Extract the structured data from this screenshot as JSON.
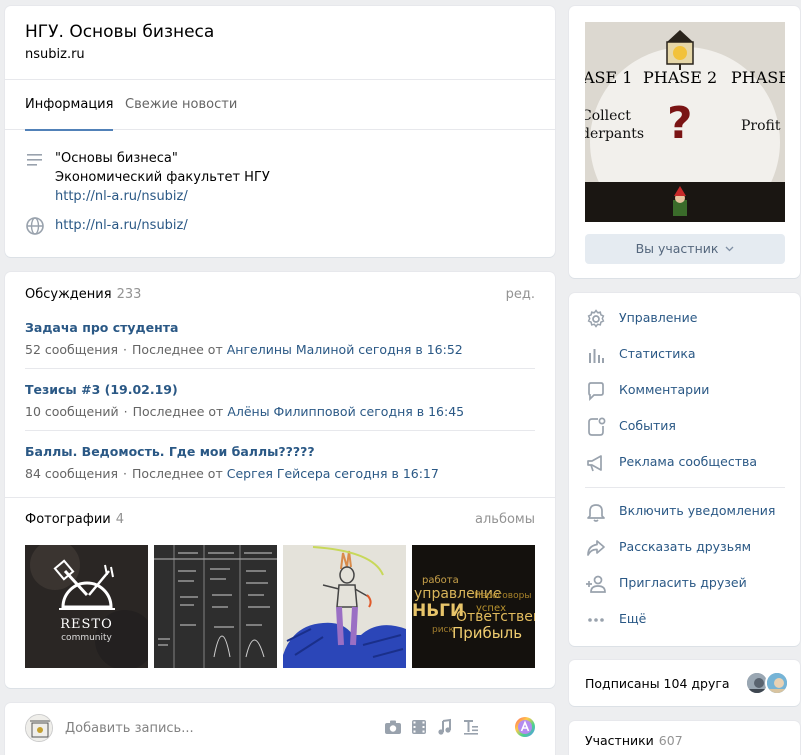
{
  "group": {
    "title": "НГУ. Основы бизнеса",
    "subtitle": "nsubiz.ru"
  },
  "tabs": [
    {
      "label": "Информация",
      "active": true
    },
    {
      "label": "Свежие новости",
      "active": false
    }
  ],
  "info": {
    "description_lines": [
      "\"Основы бизнеса\"",
      "Экономический факультет НГУ"
    ],
    "description_link": "http://nl-a.ru/nsubiz/",
    "website_link": "http://nl-a.ru/nsubiz/"
  },
  "discussions": {
    "title": "Обсуждения",
    "count": "233",
    "action": "ред.",
    "topics": [
      {
        "title": "Задача про студента",
        "count": "52 сообщения",
        "last_prefix": "Последнее от",
        "last_link": "Ангелины Малиной сегодня в 16:52"
      },
      {
        "title": "Тезисы #3 (19.02.19)",
        "count": "10 сообщений",
        "last_prefix": "Последнее от",
        "last_link": "Алёны Филипповой сегодня в 16:45"
      },
      {
        "title": "Баллы. Ведомость. Где мои баллы?????",
        "count": "84 сообщения",
        "last_prefix": "Последнее от",
        "last_link": "Сергея Гейсера сегодня в 16:17"
      }
    ]
  },
  "photos": {
    "title": "Фотографии",
    "count": "4",
    "action": "альбомы",
    "items": [
      {
        "caption_main": "RESTO",
        "caption_sub": "community"
      },
      {
        "caption_main": "",
        "caption_sub": ""
      },
      {
        "caption_main": "",
        "caption_sub": ""
      },
      {
        "words": [
          "работа",
          "управление",
          "НЬГИ",
          "успех",
          "Переговоры",
          "Ответствен",
          "риск",
          "Прибыль"
        ]
      }
    ]
  },
  "post": {
    "placeholder": "Добавить запись..."
  },
  "cover": {
    "phase_labels": [
      "ASE 1",
      "PHASE 2",
      "PHASE"
    ],
    "left_text": [
      "Collect",
      "derpants"
    ],
    "question": "?",
    "right_text": "Profit",
    "member_button": "Вы участник"
  },
  "menu": {
    "group1": [
      {
        "label": "Управление",
        "icon": "gear-icon"
      },
      {
        "label": "Статистика",
        "icon": "stats-icon"
      },
      {
        "label": "Комментарии",
        "icon": "comment-icon"
      },
      {
        "label": "События",
        "icon": "events-icon"
      },
      {
        "label": "Реклама сообщества",
        "icon": "megaphone-icon"
      }
    ],
    "group2": [
      {
        "label": "Включить уведомления",
        "icon": "bell-icon"
      },
      {
        "label": "Рассказать друзьям",
        "icon": "share-icon"
      },
      {
        "label": "Пригласить друзей",
        "icon": "invite-icon"
      },
      {
        "label": "Ещё",
        "icon": "more-icon"
      }
    ]
  },
  "friends": {
    "label": "Подписаны 104 друга"
  },
  "members": {
    "title": "Участники",
    "count": "607"
  },
  "colors": {
    "link": "#2a5885",
    "accent": "#5181b8",
    "background": "#edeef0"
  }
}
